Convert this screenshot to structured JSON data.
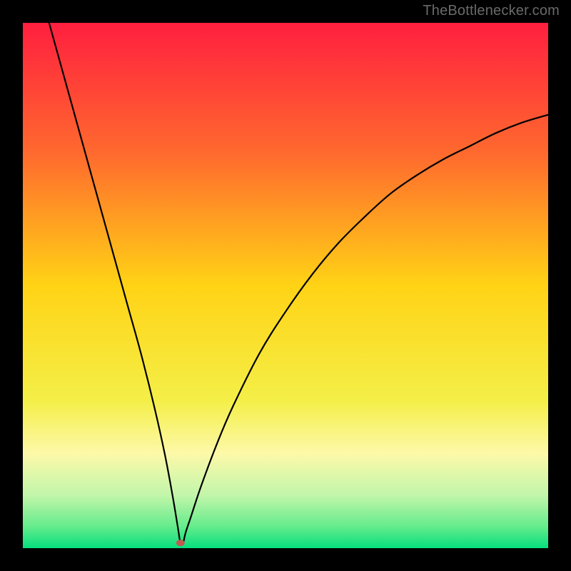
{
  "watermark": "TheBottlenecker.com",
  "chart_data": {
    "type": "line",
    "title": "",
    "xlabel": "",
    "ylabel": "",
    "xlim": [
      0,
      100
    ],
    "ylim": [
      0,
      100
    ],
    "grid": false,
    "legend": false,
    "series": [
      {
        "name": "curve",
        "x": [
          5,
          7.5,
          10,
          12.5,
          15,
          17.5,
          20,
          22.5,
          25,
          27,
          28.5,
          29.5,
          30,
          30.5,
          31,
          32,
          34,
          37,
          40,
          45,
          50,
          55,
          60,
          65,
          70,
          75,
          80,
          85,
          90,
          95,
          100
        ],
        "y": [
          100,
          91,
          82,
          73,
          64,
          55,
          46,
          37,
          27,
          18,
          10,
          4,
          1,
          1,
          3,
          6,
          12,
          20,
          27,
          37,
          45,
          52,
          58,
          63,
          67.5,
          71,
          74,
          76.5,
          79,
          81,
          82.5
        ]
      }
    ],
    "marker": {
      "x": 30,
      "y": 1,
      "color": "#bf5b51",
      "rx": 6,
      "ry": 4.5
    },
    "background_gradient": {
      "stops": [
        {
          "offset": 0,
          "color": "#ff1f3f"
        },
        {
          "offset": 25,
          "color": "#ff6a2e"
        },
        {
          "offset": 50,
          "color": "#ffd315"
        },
        {
          "offset": 72,
          "color": "#f4ef48"
        },
        {
          "offset": 82,
          "color": "#fdf9a9"
        },
        {
          "offset": 90,
          "color": "#c1f6aa"
        },
        {
          "offset": 96,
          "color": "#63eb8b"
        },
        {
          "offset": 100,
          "color": "#05df7e"
        }
      ]
    }
  }
}
